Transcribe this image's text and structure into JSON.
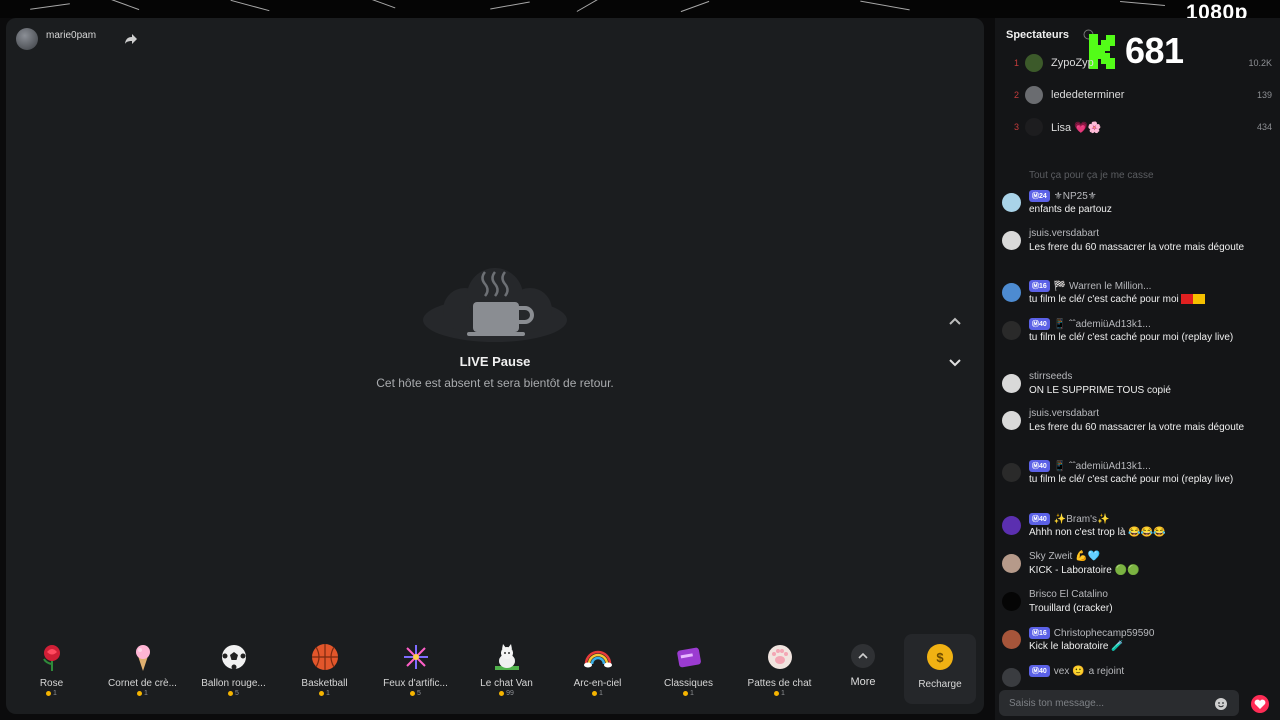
{
  "overlay": {
    "quality": "1080p",
    "kick_viewer_count": "681"
  },
  "host": {
    "name": "marie0pam"
  },
  "stream": {
    "pause_title": "LIVE Pause",
    "pause_subtitle": "Cet hôte est absent et sera bientôt de retour."
  },
  "gifts": [
    {
      "label": "Rose",
      "price": "1"
    },
    {
      "label": "Cornet de crè...",
      "price": "1"
    },
    {
      "label": "Ballon rouge...",
      "price": "5"
    },
    {
      "label": "Basketball",
      "price": "1"
    },
    {
      "label": "Feux d'artific...",
      "price": "5"
    },
    {
      "label": "Le chat Van",
      "price": "99"
    },
    {
      "label": "Arc-en-ciel",
      "price": "1"
    },
    {
      "label": "Classiques",
      "price": "1"
    },
    {
      "label": "Pattes de chat",
      "price": "1"
    }
  ],
  "gift_bar": {
    "more_label": "More",
    "recharge_label": "Recharge"
  },
  "spectators": {
    "title": "Spectateurs",
    "list": [
      {
        "rank": "1",
        "name": "ZypoZyp",
        "score": "10.2K"
      },
      {
        "rank": "2",
        "name": "lededeterminer",
        "score": "139"
      },
      {
        "rank": "3",
        "name": "Lisa 💗🌸",
        "score": "434"
      }
    ]
  },
  "chat": {
    "divider_text": "Tout ça pour ça je me casse",
    "messages": [
      {
        "badge": "Ⓜ24",
        "user": "⚜NP25⚜",
        "text": "enfants de partouz"
      },
      {
        "badge": "",
        "user": "jsuis.versdabart",
        "text": "Les frere du 60 massacrer la votre mais dégoute"
      },
      {
        "badge": "Ⓜ16",
        "user": "🏁 Warren le Million...",
        "text": "tu film le clé/ c'est caché pour moi"
      },
      {
        "badge": "Ⓜ40",
        "user": "📱 ˆˆademiüAd13k1...",
        "text": "tu film le clé/ c'est caché pour moi (replay live)"
      },
      {
        "badge": "",
        "user": "stirrseeds",
        "text": "ON LE SUPPRIME TOUS copié"
      },
      {
        "badge": "",
        "user": "jsuis.versdabart",
        "text": "Les frere du 60 massacrer la votre mais dégoute"
      },
      {
        "badge": "Ⓜ40",
        "user": "📱 ˆˆademiüAd13k1...",
        "text": "tu film le clé/ c'est caché pour moi (replay live)"
      },
      {
        "badge": "Ⓜ40",
        "user": "✨Bram's✨",
        "text": "Ahhh non c'est trop là 😂😂😂"
      },
      {
        "badge": "",
        "user": "Sky Zweit 💪🩵",
        "text": "KICK - Laboratoire 🟢🟢"
      },
      {
        "badge": "",
        "user": "Brisco El Catalino",
        "text": "Trouillard (cracker)"
      },
      {
        "badge": "Ⓜ16",
        "user": "Christophecamp59590",
        "text": "Kick le laboratoire 🧪"
      },
      {
        "badge": "Ⓜ40",
        "user": "vex 🙂",
        "text": "a rejoint"
      }
    ],
    "input_placeholder": "Saisis ton message..."
  }
}
